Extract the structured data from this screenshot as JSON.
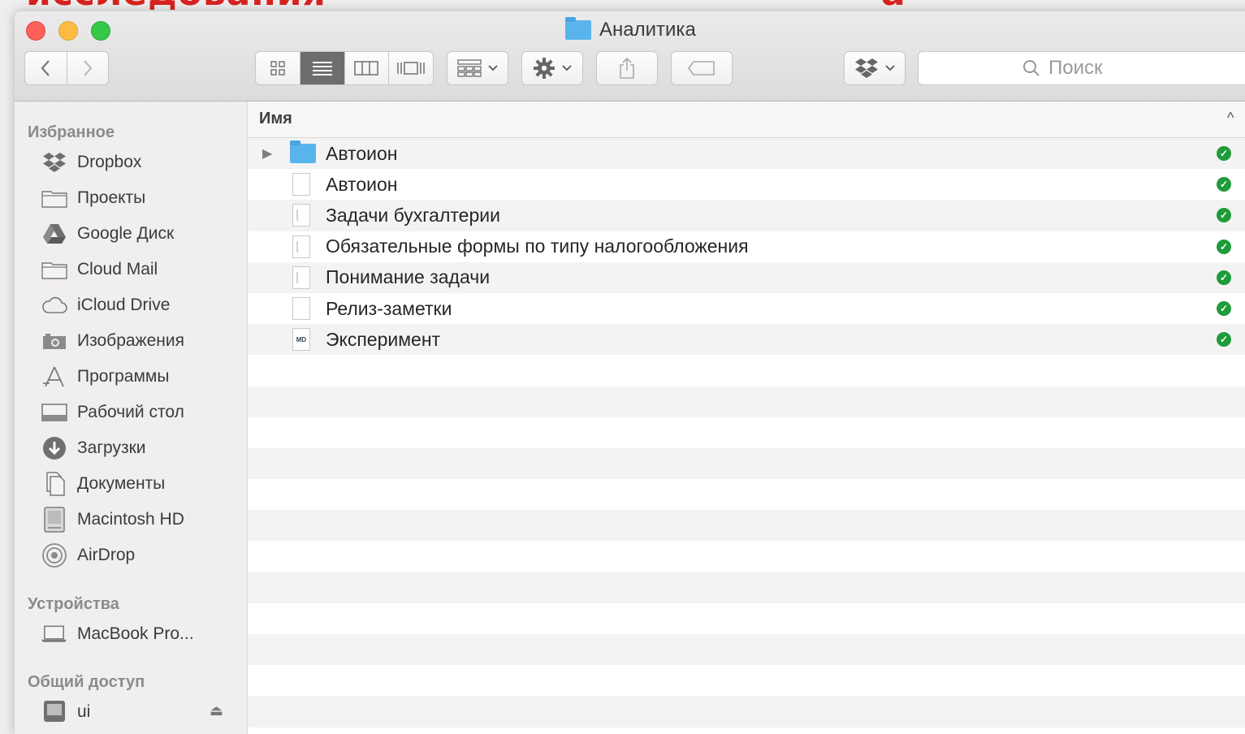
{
  "slide": {
    "title_left": "исследования",
    "title_right": "а"
  },
  "window": {
    "title": "Аналитика",
    "title_icon": "folder-icon"
  },
  "toolbar": {
    "back_icon": "chevron-left-icon",
    "forward_icon": "chevron-right-icon",
    "view_modes": [
      "icon-view-icon",
      "list-view-icon",
      "column-view-icon",
      "cover-flow-icon"
    ],
    "active_view": "list",
    "arrange_icon": "arrange-icon",
    "action_icon": "gear-icon",
    "share_icon": "share-icon",
    "tag_icon": "tag-icon",
    "dropbox_icon": "dropbox-icon",
    "search_placeholder": "Поиск"
  },
  "sidebar": {
    "sections": [
      {
        "header": "Избранное",
        "items": [
          {
            "label": "Dropbox",
            "icon": "dropbox-icon"
          },
          {
            "label": "Проекты",
            "icon": "folder-icon"
          },
          {
            "label": "Google Диск",
            "icon": "google-drive-icon"
          },
          {
            "label": "Cloud Mail",
            "icon": "folder-icon"
          },
          {
            "label": "iCloud Drive",
            "icon": "cloud-icon"
          },
          {
            "label": "Изображения",
            "icon": "camera-icon"
          },
          {
            "label": "Программы",
            "icon": "applications-icon"
          },
          {
            "label": "Рабочий стол",
            "icon": "desktop-icon"
          },
          {
            "label": "Загрузки",
            "icon": "download-icon"
          },
          {
            "label": "Документы",
            "icon": "documents-icon"
          },
          {
            "label": "Macintosh HD",
            "icon": "hard-drive-icon"
          },
          {
            "label": "AirDrop",
            "icon": "airdrop-icon"
          }
        ]
      },
      {
        "header": "Устройства",
        "items": [
          {
            "label": "MacBook Pro...",
            "icon": "laptop-icon"
          }
        ]
      },
      {
        "header": "Общий доступ",
        "items": [
          {
            "label": "ui",
            "icon": "server-icon"
          }
        ]
      }
    ]
  },
  "list": {
    "column_name": "Имя",
    "rows": [
      {
        "name": "Автоион",
        "type": "folder",
        "synced": true
      },
      {
        "name": "Автоион",
        "type": "document",
        "synced": true
      },
      {
        "name": "Задачи бухгалтерии",
        "type": "document",
        "synced": true
      },
      {
        "name": "Обязательные формы по типу налогообложения",
        "type": "document",
        "synced": true
      },
      {
        "name": "Понимание задачи",
        "type": "document",
        "synced": true
      },
      {
        "name": "Релиз-заметки",
        "type": "blank",
        "synced": true
      },
      {
        "name": "Эксперимент",
        "type": "markdown",
        "synced": true
      }
    ]
  },
  "colors": {
    "slide_title": "#d8231f",
    "sync_ok": "#1e9b3a",
    "folder": "#5ab4ec"
  }
}
